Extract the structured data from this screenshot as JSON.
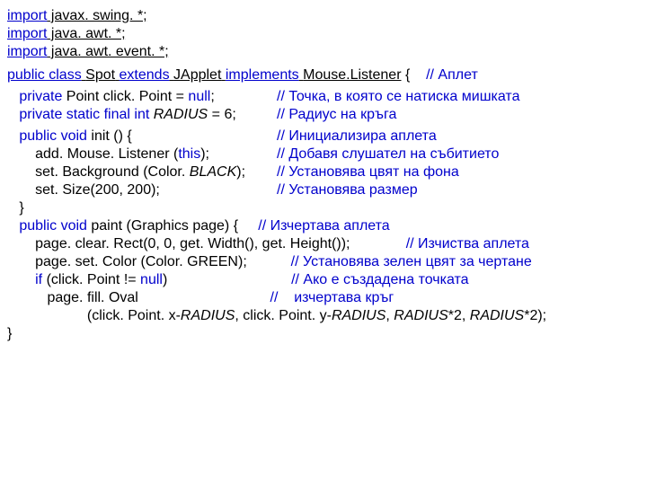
{
  "imports": {
    "l1a": "import",
    "l1b": " javax. swing. *;",
    "l2a": "import",
    "l2b": " java. awt. *;",
    "l3a": "import",
    "l3b": " java. awt. event. *;"
  },
  "classline": {
    "p1": "public class",
    "sp1": " ",
    "p2": "Spot",
    "sp2": " ",
    "p3": "extends",
    "sp3": " ",
    "p4": "JApplet",
    "sp4": " ",
    "p5": "implements",
    "sp5": " ",
    "p6": "Mouse.Listener",
    "sp6": " { ",
    "cm": "   // Аплет"
  },
  "decl": {
    "r1_left_a": "   private",
    "r1_left_b": " Point click. Point = ",
    "r1_left_c": "null",
    "r1_left_d": ";",
    "r1_cm": "// Точка, в която се натиска мишката",
    "r2_left_a": "   private static final int",
    "r2_left_b": " ",
    "r2_left_c": "RADIUS",
    "r2_left_d": " = 6;",
    "r2_cm": "// Радиус на кръга"
  },
  "init": {
    "h_a": "   public void",
    "h_b": " init () {",
    "h_cm": "// Инициализира аплета",
    "r1_a": "       add. Mouse. Listener (",
    "r1_b": "this",
    "r1_c": ");",
    "r1_cm": "// Добавя слушател на събитието",
    "r2_a": "       set. Background (Color. ",
    "r2_b": "BLACK",
    "r2_c": ");",
    "r2_cm": "// Установява цвят на фона",
    "r3_a": "       set. Size(200, 200);",
    "r3_cm": "// Установява размер",
    "close": "   }"
  },
  "paint": {
    "h_a": "   public void",
    "h_b": " paint (Graphics page) {",
    "h_cm": "     // Изчертава аплета",
    "r1": "       page. clear. Rect(0, 0, get. Width(), get. Height());",
    "r1_cm": "              // Изчиства аплета",
    "r2": "       page. set. Color (Color. GREEN);",
    "r2_cm": "           // Установява зелен цвят за чертане",
    "r3_a": "       if",
    "r3_b": " (click. Point != ",
    "r3_c": "null",
    "r3_d": ")",
    "r3_cm": "                               // Ако е създадена точката",
    "r4": "          page. fill. Oval",
    "r4_cm": "                                 //    изчертава кръг",
    "r5_a": "                    (click. Point. x-",
    "r5_b": "RADIUS",
    "r5_c": ", click. Point. y-",
    "r5_d": "RADIUS",
    "r5_e": ", ",
    "r5_f": "RADIUS",
    "r5_g": "*2, ",
    "r5_h": "RADIUS",
    "r5_i": "*2);",
    "close": "}"
  }
}
